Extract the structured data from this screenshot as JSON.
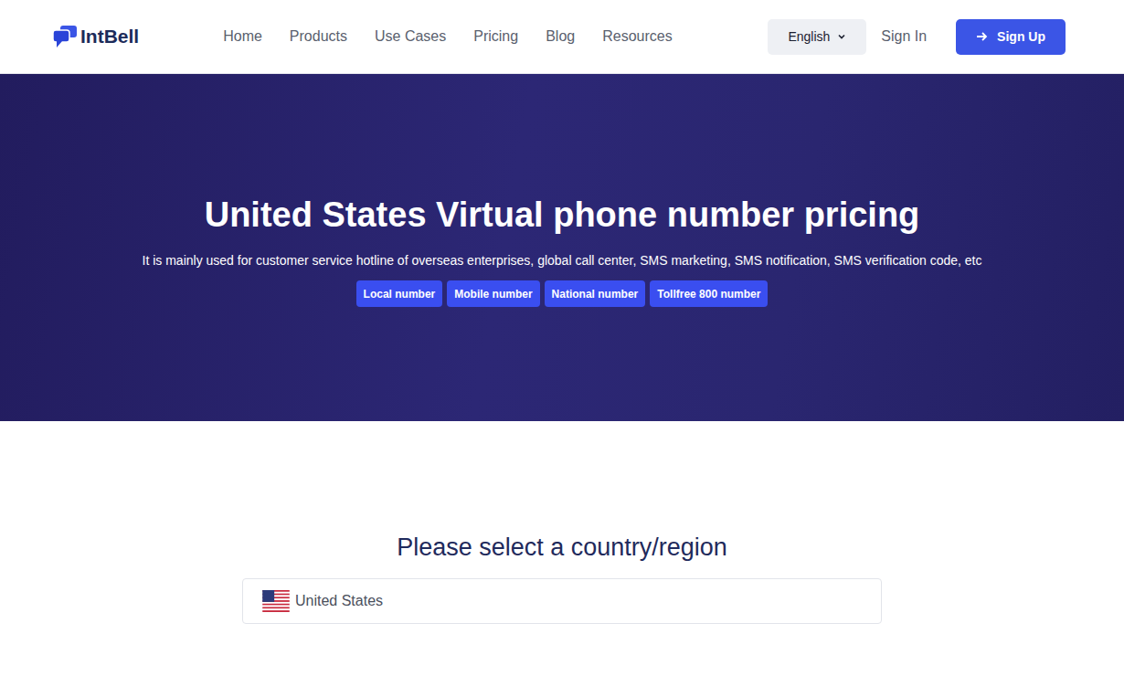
{
  "header": {
    "logo": "IntBell",
    "nav": [
      {
        "label": "Home"
      },
      {
        "label": "Products"
      },
      {
        "label": "Use Cases"
      },
      {
        "label": "Pricing"
      },
      {
        "label": "Blog"
      },
      {
        "label": "Resources"
      }
    ],
    "language": "English",
    "sign_in": "Sign In",
    "sign_up": "Sign Up"
  },
  "hero": {
    "title": "United States Virtual phone number pricing",
    "subtitle": "It is mainly used for customer service hotline of overseas enterprises, global call center, SMS marketing, SMS notification, SMS verification code, etc",
    "tags": [
      "Local number",
      "Mobile number",
      "National number",
      "Tollfree 800 number"
    ]
  },
  "country_select": {
    "heading": "Please select a country/region",
    "value": "United States"
  }
}
